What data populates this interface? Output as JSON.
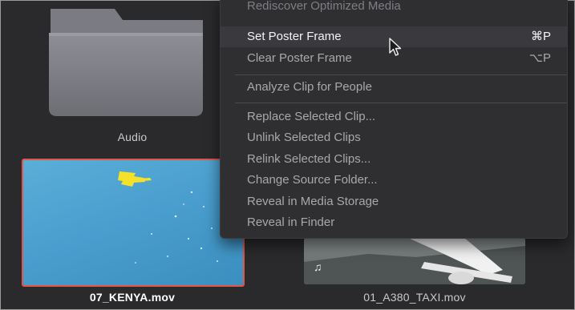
{
  "folder": {
    "label": "Audio"
  },
  "clips": [
    {
      "name": "07_KENYA.mov",
      "selected": true
    },
    {
      "name": "01_A380_TAXI.mov",
      "selected": false,
      "badge_icon": "music-note-icon"
    }
  ],
  "context_menu": {
    "items": [
      {
        "label": "Rediscover Optimized Media",
        "shortcut": "",
        "state": "partial"
      },
      {
        "label": "Set Poster Frame",
        "shortcut": "⌘P",
        "state": "highlighted"
      },
      {
        "label": "Clear Poster Frame",
        "shortcut": "⌥P",
        "state": "normal"
      },
      {
        "label": "Analyze Clip for People",
        "shortcut": "",
        "state": "normal"
      },
      {
        "label": "Replace Selected Clip...",
        "shortcut": "",
        "state": "normal"
      },
      {
        "label": "Unlink Selected Clips",
        "shortcut": "",
        "state": "normal"
      },
      {
        "label": "Relink Selected Clips...",
        "shortcut": "",
        "state": "normal"
      },
      {
        "label": "Change Source Folder...",
        "shortcut": "",
        "state": "normal"
      },
      {
        "label": "Reveal in Media Storage",
        "shortcut": "",
        "state": "normal"
      },
      {
        "label": "Reveal in Finder",
        "shortcut": "",
        "state": "normal"
      }
    ]
  },
  "colors": {
    "background": "#2a2a2d",
    "menu_background": "#2f2f32",
    "highlight": "#3a3a3e",
    "selection_border": "#e2554a"
  }
}
